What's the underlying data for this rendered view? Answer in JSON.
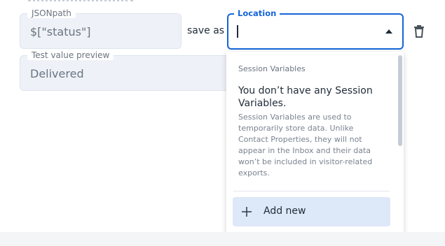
{
  "jsonpath": {
    "label": "JSONpath",
    "value": "$[\"status\"]"
  },
  "preview": {
    "label": "Test value preview",
    "value": "Delivered"
  },
  "save_as_label": "save as",
  "location": {
    "label": "Location",
    "value": ""
  },
  "dropdown": {
    "section_title": "Session Variables",
    "empty_heading": "You don’t have any Session Variables.",
    "empty_description": "Session Variables are used to temporarily store data. Unlike Contact Properties, they will not appear in the Inbox and their data won’t be included in visitor-related exports.",
    "add_new_label": "Add new"
  },
  "icons": {
    "delete": "trash-icon",
    "dropdown_toggle": "chevron-up-icon",
    "add": "plus-icon"
  },
  "colors": {
    "accent": "#1565d8",
    "field_bg": "#eef2f8",
    "add_bg": "#dde8f8"
  }
}
